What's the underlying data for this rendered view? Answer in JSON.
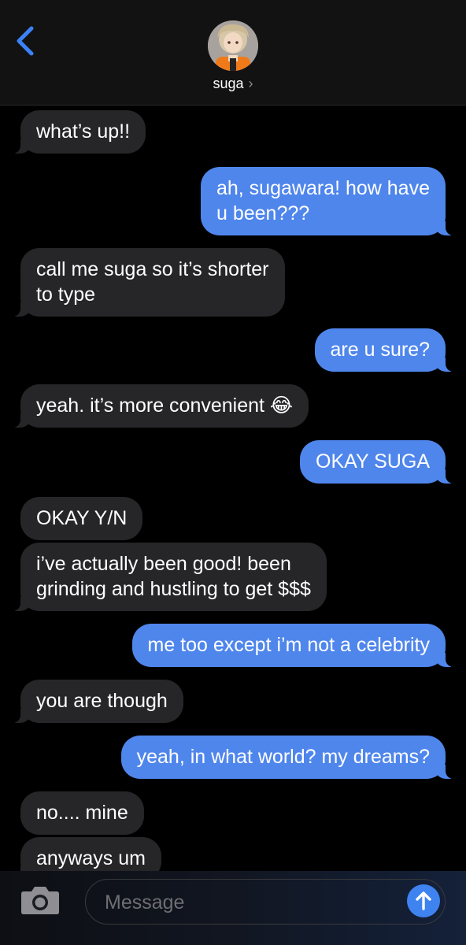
{
  "header": {
    "back_icon": "chevron-left-icon",
    "contact_name": "suga",
    "name_chevron": "›",
    "accent_color": "#3b82f6"
  },
  "messages": [
    {
      "from": "them",
      "text": "what’s up!!"
    },
    {
      "from": "me",
      "text": "ah, sugawara! how have\nu been???"
    },
    {
      "from": "them",
      "text": "call me suga so it’s shorter\nto type"
    },
    {
      "from": "me",
      "text": "are u sure?"
    },
    {
      "from": "them",
      "text": "yeah. it’s more convenient 😂"
    },
    {
      "from": "me",
      "text": "OKAY SUGA"
    },
    {
      "from": "them",
      "text": "OKAY Y/N"
    },
    {
      "from": "them",
      "text": "i’ve actually been good! been\ngrinding and hustling to get $$$"
    },
    {
      "from": "me",
      "text": "me too except i’m not a celebrity"
    },
    {
      "from": "them",
      "text": "you are though"
    },
    {
      "from": "me",
      "text": "yeah, in what world? my dreams?"
    },
    {
      "from": "them",
      "text": "no.... mine"
    },
    {
      "from": "them",
      "text": "anyways um"
    }
  ],
  "composer": {
    "placeholder": "Message",
    "value": "",
    "camera_icon": "camera-icon",
    "send_icon": "arrow-up-icon"
  },
  "colors": {
    "incoming_bubble": "#262628",
    "outgoing_bubble": "#4f86ec",
    "background": "#000000"
  }
}
